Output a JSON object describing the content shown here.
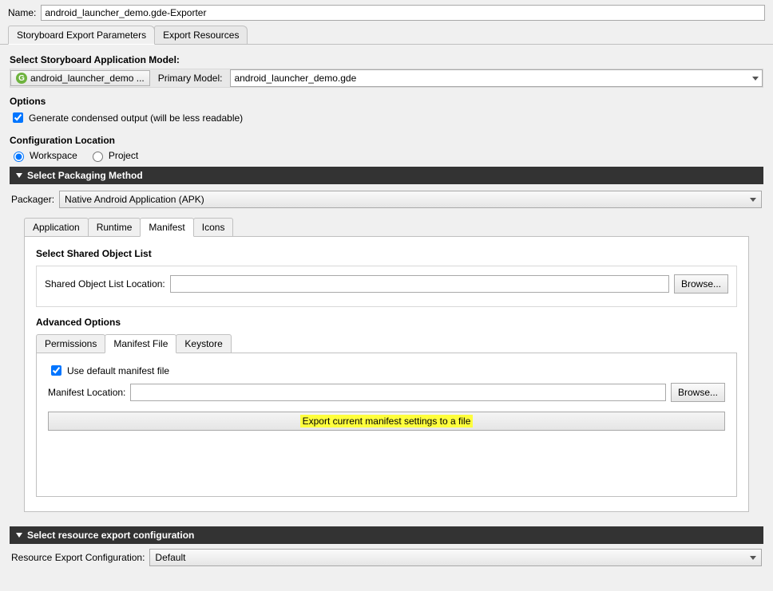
{
  "name": {
    "label": "Name:",
    "value": "android_launcher_demo.gde-Exporter"
  },
  "mainTabs": {
    "t0": "Storyboard Export Parameters",
    "t1": "Export Resources"
  },
  "modelSection": {
    "title": "Select Storyboard Application Model:",
    "button": "android_launcher_demo ...",
    "primaryLabel": "Primary Model:",
    "primaryValue": "android_launcher_demo.gde"
  },
  "options": {
    "title": "Options",
    "check1": "Generate condensed output (will be less readable)"
  },
  "configLoc": {
    "title": "Configuration Location",
    "r0": "Workspace",
    "r1": "Project"
  },
  "packaging": {
    "bar": "Select Packaging Method",
    "label": "Packager:",
    "value": "Native Android Application (APK)"
  },
  "innerTabs": {
    "t0": "Application",
    "t1": "Runtime",
    "t2": "Manifest",
    "t3": "Icons"
  },
  "sharedObj": {
    "title": "Select Shared Object List",
    "label": "Shared Object List Location:",
    "value": "",
    "browse": "Browse..."
  },
  "advOptions": {
    "title": "Advanced Options",
    "tabs": {
      "t0": "Permissions",
      "t1": "Manifest File",
      "t2": "Keystore"
    },
    "useDefault": "Use default manifest file",
    "manifestLabel": "Manifest Location:",
    "manifestValue": "",
    "browse": "Browse...",
    "exportBtn": "Export current manifest settings to a file"
  },
  "resourceExport": {
    "bar": "Select resource export configuration",
    "label": "Resource Export Configuration:",
    "value": "Default"
  }
}
